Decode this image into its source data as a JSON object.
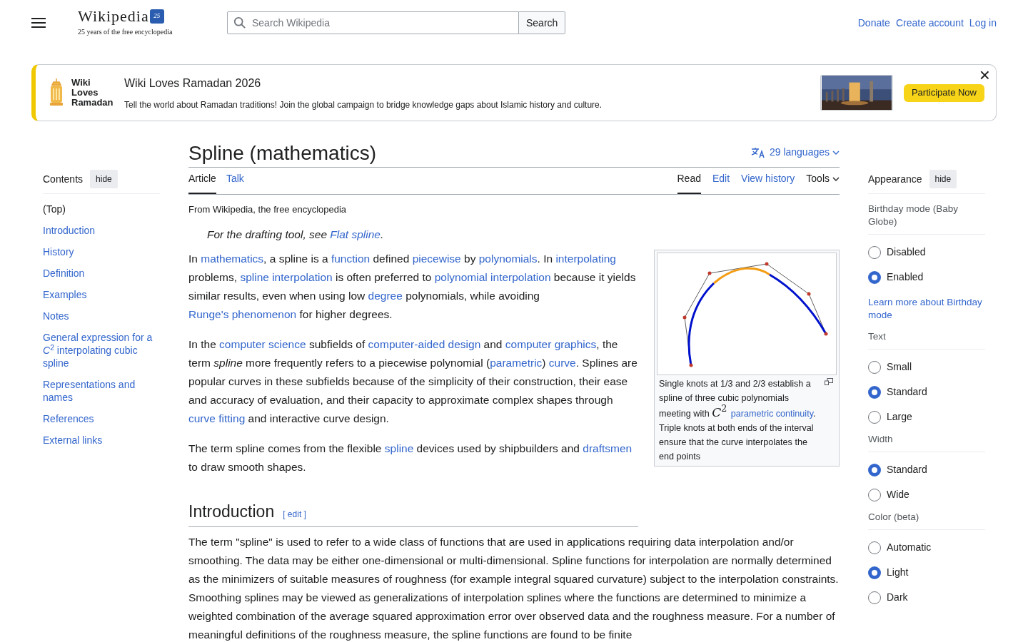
{
  "header": {
    "logo_wordmark": "Wikipedia",
    "logo_badge": "25",
    "tagline": "25 years of the free encyclopedia",
    "search": {
      "placeholder": "Search Wikipedia",
      "button": "Search"
    },
    "links": [
      "Donate",
      "Create account",
      "Log in"
    ]
  },
  "banner": {
    "logo_text": "Wiki Loves Ramadan",
    "title": "Wiki Loves Ramadan 2026",
    "text": "Tell the world about Ramadan traditions! Join the global campaign to bridge knowledge gaps about Islamic history and culture.",
    "button": "Participate Now",
    "close": "×"
  },
  "toc": {
    "title": "Contents",
    "hide": "hide",
    "items": [
      {
        "label": "(Top)",
        "selected": true
      },
      {
        "label": "Introduction",
        "selected": false
      },
      {
        "label": "History",
        "selected": false
      },
      {
        "label": "Definition",
        "selected": false
      },
      {
        "label": "Examples",
        "selected": false
      },
      {
        "label": "Notes",
        "selected": false
      },
      {
        "label": "General expression for a *C*$^{2}$ interpolating cubic spline",
        "selected": false
      },
      {
        "label": "Representations and names",
        "selected": false
      },
      {
        "label": "References",
        "selected": false
      },
      {
        "label": "External links",
        "selected": false
      }
    ]
  },
  "article": {
    "title": "Spline (mathematics)",
    "languages": "29 languages",
    "tabs_left": [
      {
        "label": "Article",
        "selected": true
      },
      {
        "label": "Talk",
        "selected": false
      }
    ],
    "tabs_right": [
      {
        "label": "Read",
        "selected": true,
        "kind": "tab"
      },
      {
        "label": "Edit",
        "selected": false,
        "kind": "tab"
      },
      {
        "label": "View history",
        "selected": false,
        "kind": "tab"
      },
      {
        "label": "Tools",
        "selected": false,
        "kind": "menu"
      }
    ],
    "tagline": "From Wikipedia, the free encyclopedia",
    "hatnote": [
      {
        "kind": "em",
        "text": "For the drafting tool, see "
      },
      {
        "kind": "link",
        "text": "Flat spline"
      },
      {
        "kind": "em",
        "text": "."
      }
    ],
    "figure": {
      "caption": [
        {
          "kind": "text",
          "text": "Single knots at 1/3 and 2/3 establish a spline of three cubic polynomials meeting with "
        },
        {
          "kind": "math",
          "text": "*C*$^{2}$ "
        },
        {
          "kind": "link",
          "text": "parametric continuity"
        },
        {
          "kind": "text",
          "text": ". Triple knots at both ends of the interval ensure that the curve interpolates the end points"
        }
      ]
    },
    "paragraphs": [
      [
        {
          "kind": "text",
          "text": "In "
        },
        {
          "kind": "link",
          "text": "mathematics"
        },
        {
          "kind": "text",
          "text": ", a spline is a "
        },
        {
          "kind": "link",
          "text": "function"
        },
        {
          "kind": "text",
          "text": " defined "
        },
        {
          "kind": "link",
          "text": "piecewise"
        },
        {
          "kind": "text",
          "text": " by "
        },
        {
          "kind": "link",
          "text": "polynomials"
        },
        {
          "kind": "text",
          "text": ". In "
        },
        {
          "kind": "link",
          "text": "interpolating"
        },
        {
          "kind": "text",
          "text": " problems, "
        },
        {
          "kind": "link",
          "text": "spline interpolation"
        },
        {
          "kind": "text",
          "text": " is often preferred to "
        },
        {
          "kind": "link",
          "text": "polynomial interpolation"
        },
        {
          "kind": "text",
          "text": " because it yields similar results, even when using low "
        },
        {
          "kind": "link",
          "text": "degree"
        },
        {
          "kind": "text",
          "text": " polynomials, while avoiding "
        },
        {
          "kind": "link",
          "text": "Runge's phenomenon"
        },
        {
          "kind": "text",
          "text": " for higher degrees."
        }
      ],
      [
        {
          "kind": "text",
          "text": "In the "
        },
        {
          "kind": "link",
          "text": "computer science"
        },
        {
          "kind": "text",
          "text": " subfields of "
        },
        {
          "kind": "link",
          "text": "computer-aided design"
        },
        {
          "kind": "text",
          "text": " and "
        },
        {
          "kind": "link",
          "text": "computer graphics"
        },
        {
          "kind": "text",
          "text": ", the term "
        },
        {
          "kind": "em",
          "text": "spline"
        },
        {
          "kind": "text",
          "text": " more frequently refers to a piecewise polynomial ("
        },
        {
          "kind": "link",
          "text": "parametric"
        },
        {
          "kind": "text",
          "text": ") "
        },
        {
          "kind": "link",
          "text": "curve"
        },
        {
          "kind": "text",
          "text": ". Splines are popular curves in these subfields because of the simplicity of their construction, their ease and accuracy of evaluation, and their capacity to approximate complex shapes through "
        },
        {
          "kind": "link",
          "text": "curve fitting"
        },
        {
          "kind": "text",
          "text": " and interactive curve design."
        }
      ],
      [
        {
          "kind": "text",
          "text": "The term spline comes from the flexible "
        },
        {
          "kind": "link",
          "text": "spline"
        },
        {
          "kind": "text",
          "text": " devices used by shipbuilders and "
        },
        {
          "kind": "link",
          "text": "draftsmen"
        },
        {
          "kind": "text",
          "text": " to draw smooth shapes."
        }
      ]
    ],
    "section": {
      "heading": "Introduction",
      "edit": "[ edit ]",
      "paragraph": "The term \"spline\" is used to refer to a wide class of functions that are used in applications requiring data interpolation and/or smoothing. The data may be either one-dimensional or multi-dimensional. Spline functions for interpolation are normally determined as the minimizers of suitable measures of roughness (for example integral squared curvature) subject to the interpolation constraints. Smoothing splines may be viewed as generalizations of interpolation splines where the functions are determined to minimize a weighted combination of the average squared approximation error over observed data and the roughness measure. For a number of meaningful definitions of the roughness measure, the spline functions are found to be finite"
    }
  },
  "appearance": {
    "title": "Appearance",
    "hide": "hide",
    "groups": [
      {
        "title": "Birthday mode (Baby Globe)",
        "options": [
          {
            "label": "Disabled",
            "selected": false
          },
          {
            "label": "Enabled",
            "selected": true
          }
        ],
        "link": "Learn more about Birthday mode"
      },
      {
        "title": "Text",
        "options": [
          {
            "label": "Small",
            "selected": false
          },
          {
            "label": "Standard",
            "selected": true
          },
          {
            "label": "Large",
            "selected": false
          }
        ]
      },
      {
        "title": "Width",
        "options": [
          {
            "label": "Standard",
            "selected": true
          },
          {
            "label": "Wide",
            "selected": false
          }
        ]
      },
      {
        "title": "Color (beta)",
        "options": [
          {
            "label": "Automatic",
            "selected": false
          },
          {
            "label": "Light",
            "selected": true
          },
          {
            "label": "Dark",
            "selected": false
          }
        ]
      }
    ]
  }
}
